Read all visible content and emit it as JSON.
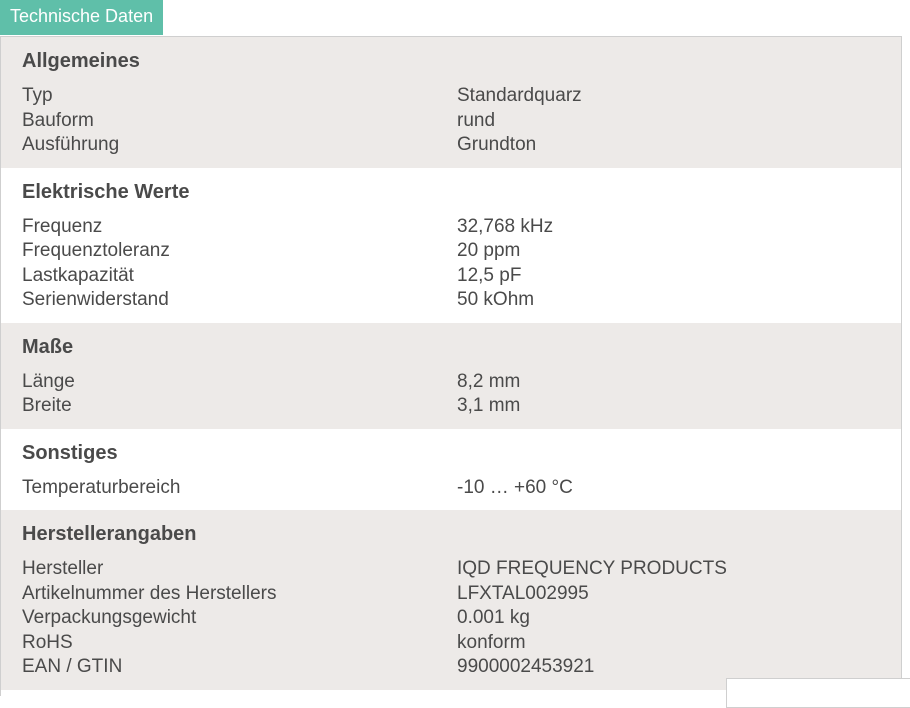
{
  "tab": {
    "label": "Technische Daten"
  },
  "sections": [
    {
      "title": "Allgemeines",
      "rows": [
        {
          "label": "Typ",
          "value": "Standardquarz"
        },
        {
          "label": "Bauform",
          "value": "rund"
        },
        {
          "label": "Ausführung",
          "value": "Grundton"
        }
      ]
    },
    {
      "title": "Elektrische Werte",
      "rows": [
        {
          "label": "Frequenz",
          "value": "32,768 kHz"
        },
        {
          "label": "Frequenztoleranz",
          "value": "20 ppm"
        },
        {
          "label": "Lastkapazität",
          "value": "12,5 pF"
        },
        {
          "label": "Serienwiderstand",
          "value": "50 kOhm"
        }
      ]
    },
    {
      "title": "Maße",
      "rows": [
        {
          "label": "Länge",
          "value": "8,2 mm"
        },
        {
          "label": "Breite",
          "value": "3,1 mm"
        }
      ]
    },
    {
      "title": "Sonstiges",
      "rows": [
        {
          "label": "Temperaturbereich",
          "value": "-10 … +60 °C"
        }
      ]
    },
    {
      "title": "Herstellerangaben",
      "rows": [
        {
          "label": "Hersteller",
          "value": "IQD FREQUENCY PRODUCTS"
        },
        {
          "label": "Artikelnummer des Herstellers",
          "value": "LFXTAL002995"
        },
        {
          "label": "Verpackungsgewicht",
          "value": "0.001 kg"
        },
        {
          "label": "RoHS",
          "value": "konform"
        },
        {
          "label": "EAN / GTIN",
          "value": "9900002453921"
        }
      ]
    }
  ],
  "colors": {
    "tab_background": "#5fbfa9",
    "shaded_section": "#edeae8",
    "text": "#4a4a4a"
  }
}
